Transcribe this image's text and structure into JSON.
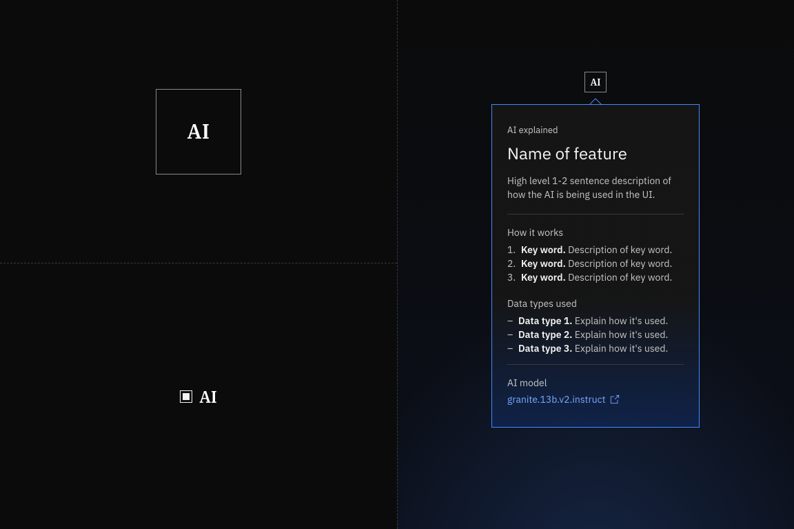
{
  "left": {
    "big_ai_label": "AI",
    "inline_ai_label": "AI"
  },
  "badge": {
    "label": "AI"
  },
  "popover": {
    "eyebrow": "AI explained",
    "title": "Name of feature",
    "description": "High level 1-2 sentence description of how the AI is being used in the UI.",
    "how_label": "How it works",
    "how_items": [
      {
        "bold": "Key word.",
        "rest": " Description of key word."
      },
      {
        "bold": "Key word.",
        "rest": " Description of key word."
      },
      {
        "bold": "Key word.",
        "rest": " Description of key word."
      }
    ],
    "data_label": "Data types used",
    "data_items": [
      {
        "bold": "Data type 1.",
        "rest": " Explain how it's used."
      },
      {
        "bold": "Data type 2.",
        "rest": " Explain how it's used."
      },
      {
        "bold": "Data type 3.",
        "rest": " Explain how it's used."
      }
    ],
    "model_label": "AI model",
    "model_link_text": "granite.13b.v2.instruct"
  }
}
